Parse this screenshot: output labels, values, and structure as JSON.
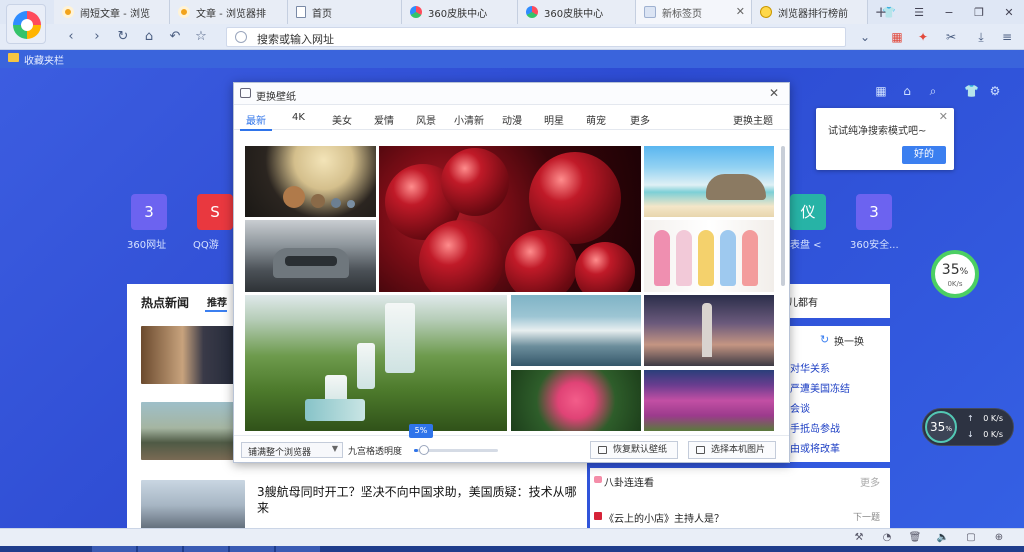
{
  "tabs": [
    {
      "title": "闹短文章 - 浏览",
      "icon": "dot-icon"
    },
    {
      "title": "文章 - 浏览器排",
      "icon": "dot-icon"
    },
    {
      "title": "首页",
      "icon": "doc-icon"
    },
    {
      "title": "360皮肤中心",
      "icon": "ring-icon"
    },
    {
      "title": "360皮肤中心",
      "icon": "ring-icon"
    },
    {
      "title": "新标签页",
      "icon": "newtab-icon"
    },
    {
      "title": "浏览器排行榜前",
      "icon": "rank-icon"
    }
  ],
  "address_bar": {
    "placeholder": "搜索或输入网址"
  },
  "bookmarks": {
    "folder_label": "收藏夹栏"
  },
  "tooltip": {
    "text": "试试纯净搜索模式吧~",
    "ok_label": "好的"
  },
  "shortcuts": [
    {
      "glyph": "3",
      "label": "360网址",
      "color": "#6c63f0"
    },
    {
      "glyph": "S",
      "label": "QQ游",
      "color": "#e9383f"
    },
    {
      "glyph": "仪",
      "label": "表盘 <",
      "color": "#27b3a6"
    },
    {
      "glyph": "3",
      "label": "360安全...",
      "color": "#6c63f0"
    }
  ],
  "speed_top": {
    "value": "35",
    "unit": "%",
    "rate": "0K/s"
  },
  "speed_bottom": {
    "value": "35",
    "unit": "%",
    "up": "0",
    "down": "0",
    "up_unit": "K/s",
    "down_unit": "K/s"
  },
  "news": {
    "heading": "热点新闻",
    "tab_label": "推荐",
    "article_title": "3艘航母同时开工？坚决不向中国求助，美国质疑：技术从哪来"
  },
  "right_panel": {
    "strip_text": "儿都有",
    "refresh_label": "换一换",
    "links": [
      "对华关系",
      "严遭美国冻结",
      "会谈",
      "手抵岛参战",
      "由或将改革"
    ]
  },
  "lower_card": {
    "item1": "八卦连连看",
    "item2": "《云上的小店》主持人是？",
    "more_label": "更多",
    "next_label": "下一题"
  },
  "dialog": {
    "title": "更换壁纸",
    "categories": [
      "最新",
      "4K",
      "美女",
      "爱情",
      "风景",
      "小清新",
      "动漫",
      "明星",
      "萌宠",
      "更多"
    ],
    "more_themes": "更换主题",
    "fit_select": "铺满整个浏览器",
    "opacity_label": "九宫格透明度",
    "opacity_value": "5%",
    "opacity_fraction": 0.05,
    "restore_label": "恢复默认壁纸",
    "local_label": "选择本机图片"
  }
}
